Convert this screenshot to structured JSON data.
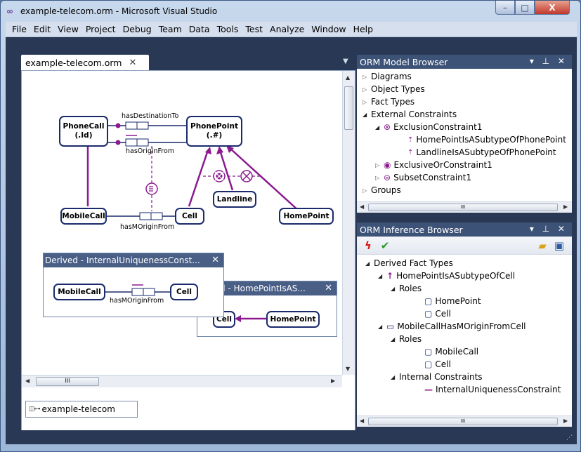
{
  "window": {
    "title": "example-telecom.orm - Microsoft Visual Studio",
    "minimize": "–",
    "maximize": "□",
    "close": "X"
  },
  "menu": [
    "File",
    "Edit",
    "View",
    "Project",
    "Debug",
    "Team",
    "Data",
    "Tools",
    "Test",
    "Analyze",
    "Window",
    "Help"
  ],
  "document": {
    "tab_label": "example-telecom.orm",
    "bottom_tab_label": "example-telecom"
  },
  "diagram": {
    "entities": {
      "phonecall": [
        "PhoneCall",
        "(.Id)"
      ],
      "phonepoint": [
        "PhonePoint",
        "(.#)"
      ],
      "mobilecall": "MobileCall",
      "cell": "Cell",
      "landline": "Landline",
      "homepoint": "HomePoint"
    },
    "facts": {
      "has_destination_to": "hasDestinationTo",
      "has_origin_from": "hasOriginFrom",
      "has_m_origin_from": "hasMOriginFrom"
    }
  },
  "derived_windows": {
    "first": {
      "title": "Derived - InternalUniquenessConst...",
      "mobilecall": "MobileCall",
      "cell": "Cell",
      "fact": "hasMOriginFrom"
    },
    "second": {
      "title": "d - HomePointIsAS...",
      "cell": "Cell",
      "homepoint": "HomePoint"
    }
  },
  "model_browser": {
    "title": "ORM Model Browser",
    "items": {
      "diagrams": "Diagrams",
      "object_types": "Object Types",
      "fact_types": "Fact Types",
      "external_constraints": "External Constraints",
      "exclusion_constraint": "ExclusionConstraint1",
      "home_subtype": "HomePointIsASubtypeOfPhonePoint",
      "landline_subtype": "LandlineIsASubtypeOfPhonePoint",
      "exclusive_or": "ExclusiveOrConstraint1",
      "subset": "SubsetConstraint1",
      "groups": "Groups"
    }
  },
  "inference_browser": {
    "title": "ORM Inference Browser",
    "items": {
      "derived_fact_types": "Derived Fact Types",
      "home_subtype_cell": "HomePointIsASubtypeOfCell",
      "roles_1": "Roles",
      "homepoint": "HomePoint",
      "cell_1": "Cell",
      "mobile_origin": "MobileCallHasMOriginFromCell",
      "roles_2": "Roles",
      "mobilecall": "MobileCall",
      "cell_2": "Cell",
      "internal_constraints": "Internal Constraints",
      "internal_uniqueness": "InternalUniquenessConstraint"
    }
  },
  "colors": {
    "entity_border": "#1a2a6c",
    "constraint": "#8b1a8f",
    "tool_header": "#3d5277",
    "workspace": "#293955"
  }
}
